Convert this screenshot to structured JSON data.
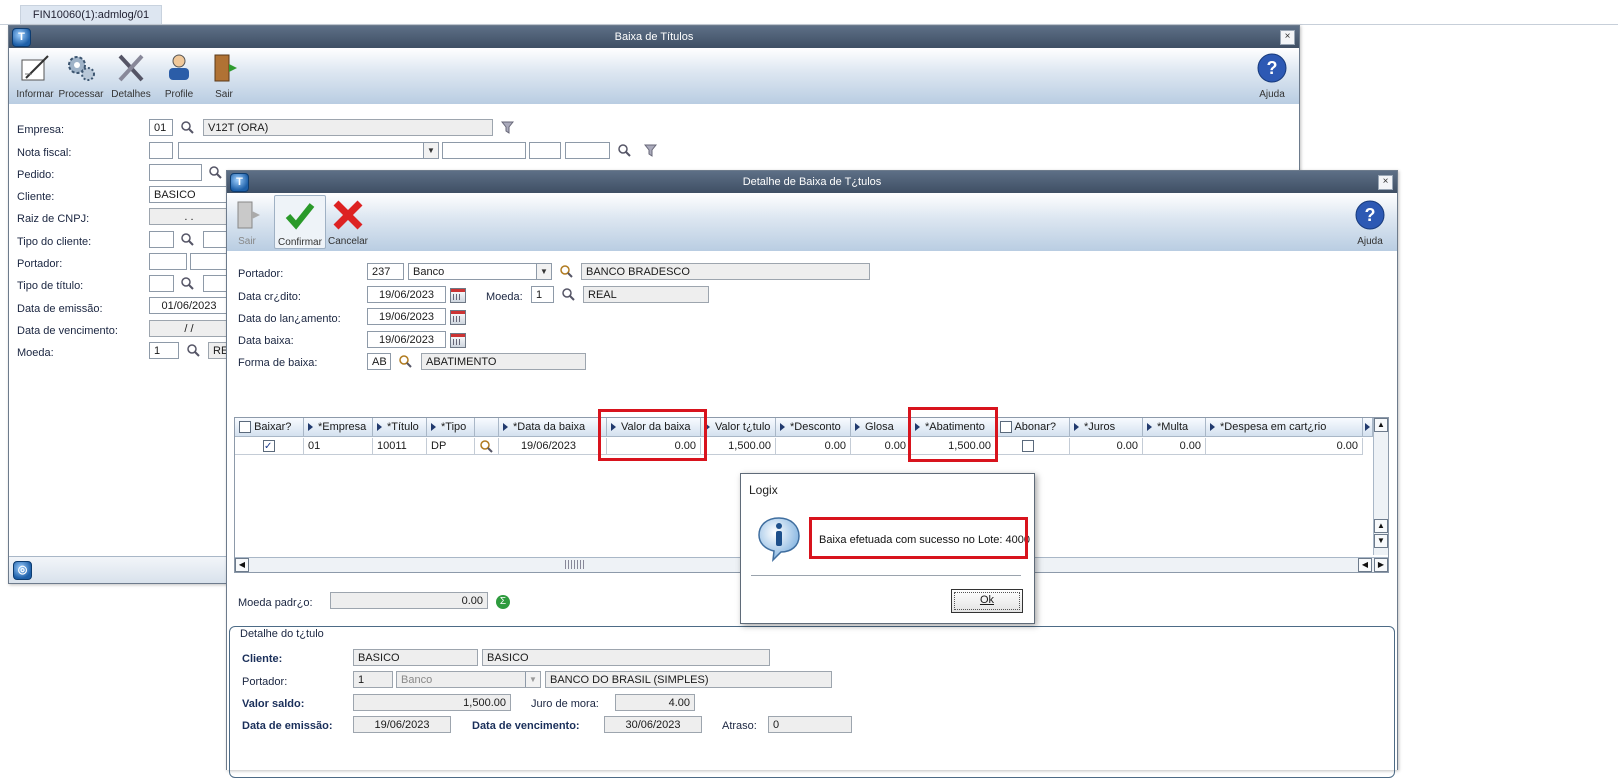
{
  "tab": {
    "label": "FIN10060(1):admlog/01"
  },
  "main_window": {
    "title": "Baixa de Títulos",
    "toolbar": [
      "Informar",
      "Processar",
      "Detalhes",
      "Profile",
      "Sair"
    ],
    "help": "Ajuda",
    "labels": {
      "empresa": "Empresa:",
      "nota_fiscal": "Nota fiscal:",
      "pedido": "Pedido:",
      "cliente": "Cliente:",
      "raiz_cnpj": "Raiz de CNPJ:",
      "tipo_cliente": "Tipo do cliente:",
      "portador": "Portador:",
      "tipo_titulo": "Tipo de título:",
      "data_emissao": "Data de emissão:",
      "data_vencimento": "Data de vencimento:",
      "moeda": "Moeda:"
    },
    "values": {
      "empresa_code": "01",
      "empresa_desc": "V12T (ORA)",
      "cliente": "BASICO",
      "raiz_cnpj": ".  .",
      "data_emissao": "01/06/2023",
      "data_vencimento": "/  /",
      "moeda_code": "1",
      "moeda_desc": "RE"
    }
  },
  "detail_window": {
    "title": "Detalhe de Baixa de T¿tulos",
    "toolbar": [
      "Sair",
      "Confirmar",
      "Cancelar"
    ],
    "help": "Ajuda",
    "labels": {
      "portador": "Portador:",
      "data_credito": "Data cr¿dito:",
      "data_lancamento": "Data do lan¿amento:",
      "data_baixa": "Data baixa:",
      "forma_baixa": "Forma de  baixa:",
      "moeda": "Moeda:",
      "moeda_padrao": "Moeda padr¿o:"
    },
    "values": {
      "portador_code": "237",
      "portador_tipo": "Banco",
      "portador_nome": "BANCO BRADESCO",
      "data_credito": "19/06/2023",
      "data_lancamento": "19/06/2023",
      "data_baixa": "19/06/2023",
      "moeda_code": "1",
      "moeda_nome": "REAL",
      "forma_code": "AB",
      "forma_nome": "ABATIMENTO",
      "moeda_padrao": "0.00"
    },
    "grid": {
      "headers": [
        "Baixar?",
        "*Empresa",
        "*Título",
        "*Tipo",
        "*Data da baixa",
        "Valor da baixa",
        "Valor t¿tulo",
        "*Desconto",
        "Glosa",
        "*Abatimento",
        "Abonar?",
        "*Juros",
        "*Multa",
        "*Despesa em cart¿rio"
      ],
      "row": {
        "empresa": "01",
        "titulo": "10011",
        "tipo": "DP",
        "data_baixa": "19/06/2023",
        "valor_baixa": "0.00",
        "valor_titulo": "1,500.00",
        "desconto": "0.00",
        "glosa": "0.00",
        "abatimento": "1,500.00",
        "juros": "0.00",
        "multa": "0.00",
        "despesa": "0.00"
      }
    },
    "detalhe_titulo": {
      "title": "Detalhe do t¿tulo",
      "labels": {
        "cliente": "Cliente:",
        "portador": "Portador:",
        "valor_saldo": "Valor saldo:",
        "juro_mora": "Juro de mora:",
        "data_emissao": "Data de emissão:",
        "data_vencimento": "Data de vencimento:",
        "atraso": "Atraso:"
      },
      "values": {
        "cliente_code": "BASICO",
        "cliente_nome": "BASICO",
        "portador_code": "1",
        "portador_tipo": "Banco",
        "portador_nome": "BANCO DO BRASIL (SIMPLES)",
        "valor_saldo": "1,500.00",
        "juro_mora": "4.00",
        "data_emissao": "19/06/2023",
        "data_vencimento": "30/06/2023",
        "atraso": "0"
      }
    }
  },
  "dialog": {
    "title": "Logix",
    "message": "Baixa efetuada com sucesso no Lote: 4000",
    "ok": "Ok"
  },
  "colors": {
    "highlight": "#d8131d",
    "titlebar": "#4b5b70"
  }
}
